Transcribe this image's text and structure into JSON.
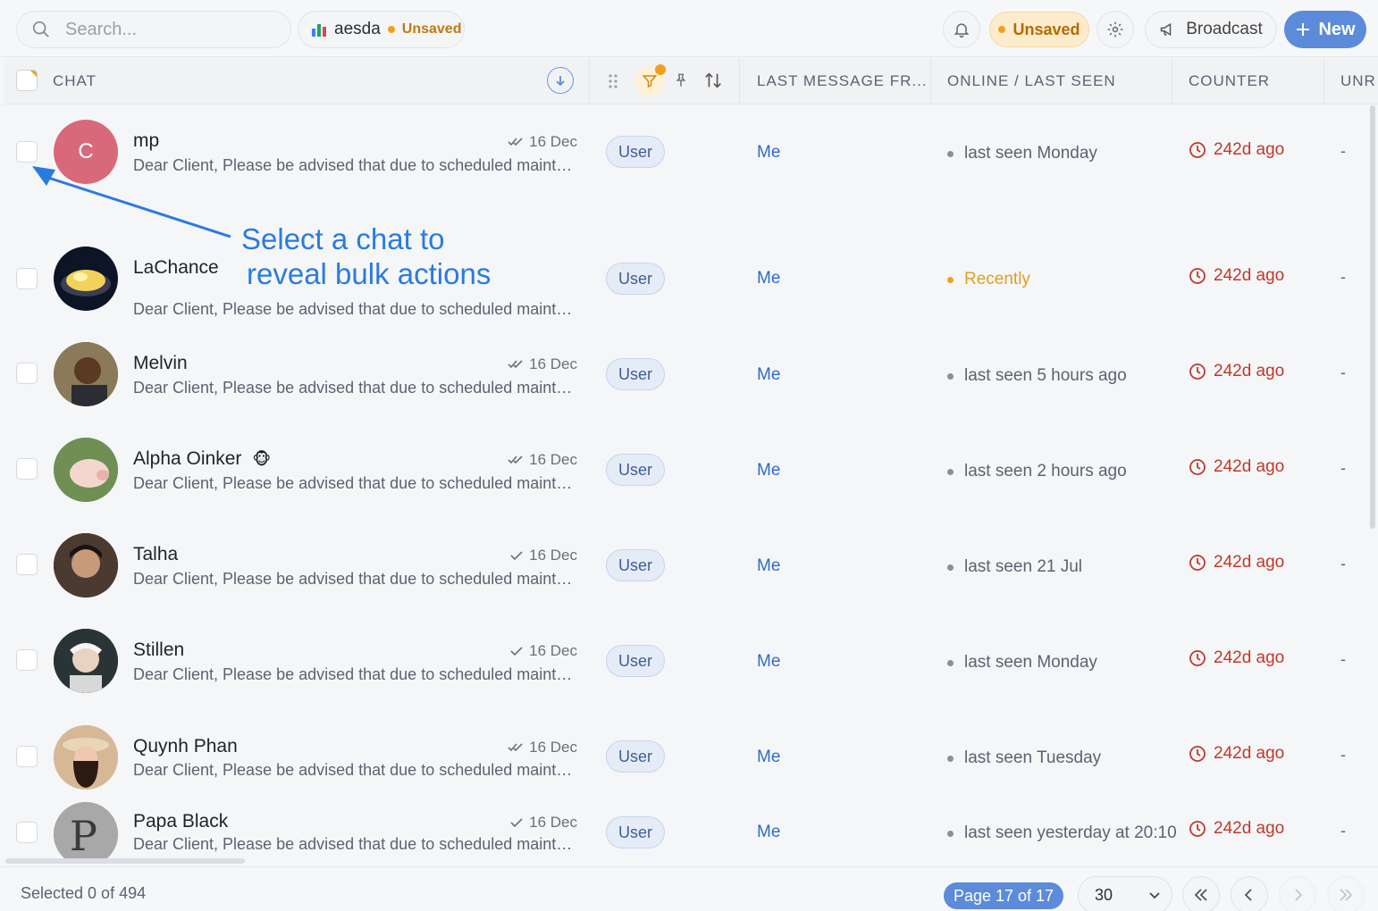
{
  "search": {
    "placeholder": "Search..."
  },
  "project": {
    "name": "aesda",
    "status": "Unsaved"
  },
  "toolbar": {
    "unsaved_label": "Unsaved",
    "broadcast_label": "Broadcast",
    "new_label": "New"
  },
  "columns": {
    "chat": "CHAT",
    "last_message_from": "LAST MESSAGE FR...",
    "online": "ONLINE / LAST SEEN",
    "counter": "COUNTER",
    "unread": "UNR"
  },
  "rows": [
    {
      "name": "mp",
      "initial": "C",
      "date": "16 Dec",
      "check": "double",
      "message": "Dear Client, Please be advised that due to scheduled maintenance our services will be unavailable",
      "role": "User",
      "last_from": "Me",
      "seen": "last seen Monday",
      "counter": "242d ago",
      "unread": "-"
    },
    {
      "name": "LaChance",
      "date": "",
      "check": "",
      "message": "Dear Client, Please be advised that due to scheduled maintenance our services will be unavailable",
      "role": "User",
      "last_from": "Me",
      "seen": "Recently",
      "counter": "242d ago",
      "unread": "-"
    },
    {
      "name": "Melvin",
      "date": "16 Dec",
      "check": "double",
      "message": "Dear Client, Please be advised that due to scheduled maintenance our services will be unavailable",
      "role": "User",
      "last_from": "Me",
      "seen": "last seen 5 hours ago",
      "counter": "242d ago",
      "unread": "-"
    },
    {
      "name": "Alpha Oinker",
      "emoji": "🐵",
      "date": "16 Dec",
      "check": "double",
      "message": "Dear Client, Please be advised that due to scheduled maintenance our services will be unavailable",
      "role": "User",
      "last_from": "Me",
      "seen": "last seen 2 hours ago",
      "counter": "242d ago",
      "unread": "-"
    },
    {
      "name": "Talha",
      "date": "16 Dec",
      "check": "single",
      "message": "Dear Client, Please be advised that due to scheduled maintenance our services will be unavailable",
      "role": "User",
      "last_from": "Me",
      "seen": "last seen 21 Jul",
      "counter": "242d ago",
      "unread": "-"
    },
    {
      "name": "Stillen",
      "date": "16 Dec",
      "check": "single",
      "message": "Dear Client, Please be advised that due to scheduled maintenance our services will be unavailable",
      "role": "User",
      "last_from": "Me",
      "seen": "last seen Monday",
      "counter": "242d ago",
      "unread": "-"
    },
    {
      "name": "Quynh Phan",
      "date": "16 Dec",
      "check": "double",
      "message": "Dear Client, Please be advised that due to scheduled maintenance our services will be unavailable",
      "role": "User",
      "last_from": "Me",
      "seen": "last seen Tuesday",
      "counter": "242d ago",
      "unread": "-"
    },
    {
      "name": "Papa Black",
      "date": "16 Dec",
      "check": "single",
      "message": "Dear Client, Please be advised that due to scheduled maintenance our services will be unavailable",
      "role": "User",
      "last_from": "Me",
      "seen": "last seen yesterday at 20:10",
      "counter": "242d ago",
      "unread": "-"
    }
  ],
  "annotation": {
    "line1": "Select a chat to",
    "line2": "reveal bulk actions"
  },
  "footer": {
    "selected": "Selected 0 of 494",
    "page": "Page 17 of 17",
    "per_page": "30"
  },
  "colors": {
    "accent": "#5b8bd9",
    "warning": "#f0a020",
    "danger": "#c0392b",
    "annotation": "#2a7be0"
  }
}
